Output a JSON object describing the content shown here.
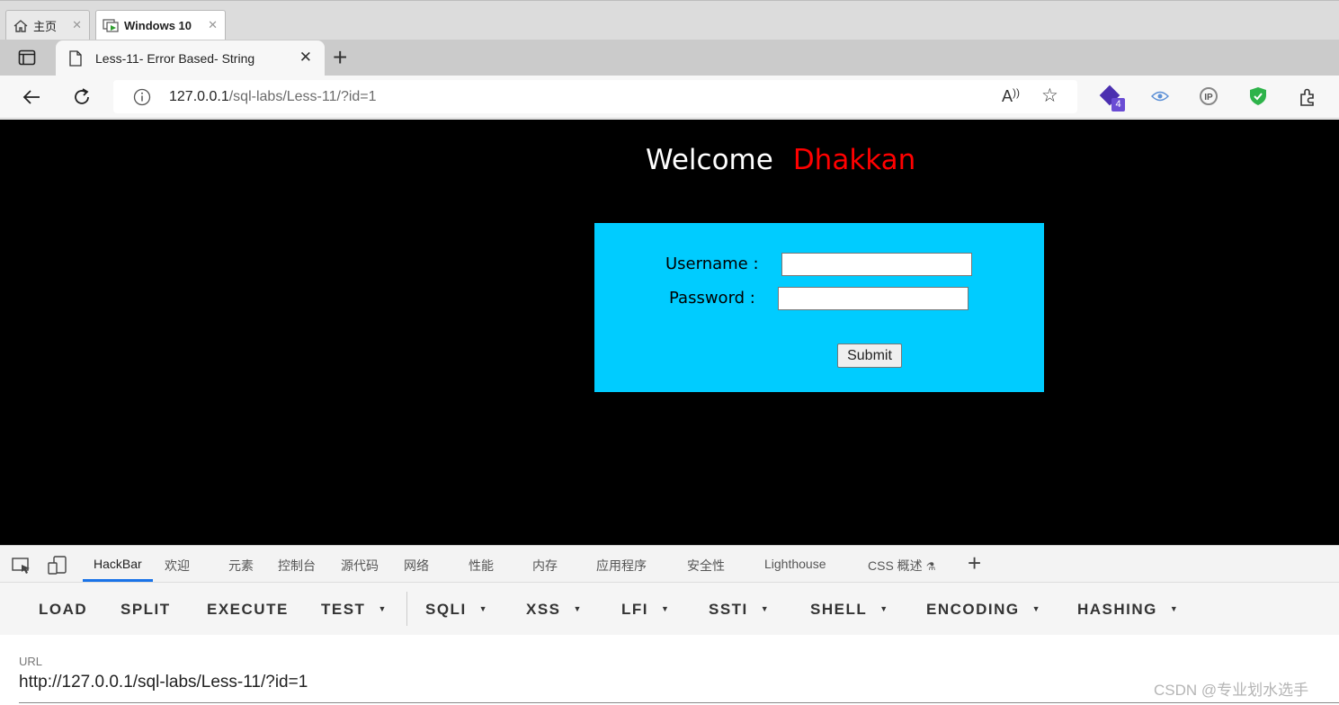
{
  "vm_tabs": [
    {
      "label": "主页",
      "icon": "home-icon"
    },
    {
      "label": "Windows 10",
      "icon": "vm-icon"
    }
  ],
  "browser": {
    "tab_title": "Less-11- Error Based- String",
    "new_tab_symbol": "+",
    "url_host": "127.0.0.1",
    "url_path": "/sql-labs/Less-11/?id=1",
    "extension_badge": "4"
  },
  "page": {
    "welcome": "Welcome",
    "name": "Dhakkan",
    "username_label": "Username :",
    "password_label": "Password :",
    "submit_label": "Submit",
    "colors": {
      "background": "#000000",
      "name": "#ff0000",
      "form_box": "#00ccff"
    }
  },
  "devtools": {
    "tabs": [
      "HackBar",
      "欢迎",
      "元素",
      "控制台",
      "源代码",
      "网络",
      "性能",
      "内存",
      "应用程序",
      "安全性",
      "Lighthouse",
      "CSS 概述"
    ],
    "active_tab": "HackBar",
    "add_symbol": "+"
  },
  "hackbar": {
    "buttons": [
      "LOAD",
      "SPLIT",
      "EXECUTE",
      "TEST",
      "SQLI",
      "XSS",
      "LFI",
      "SSTI",
      "SHELL",
      "ENCODING",
      "HASHING"
    ],
    "url_label": "URL",
    "url_value": "http://127.0.0.1/sql-labs/Less-11/?id=1"
  },
  "watermark": "CSDN @专业划水选手"
}
